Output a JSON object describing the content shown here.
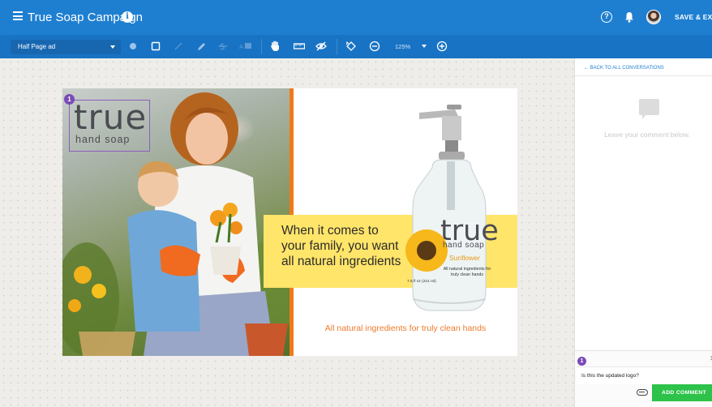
{
  "header": {
    "title": "True Soap Campaign",
    "save_exit": "SAVE & EXIT",
    "icons": [
      "menu-icon",
      "info-icon",
      "help-icon",
      "bell-icon",
      "avatar"
    ]
  },
  "toolbar": {
    "size_select": "Half Page ad",
    "zoom": "125%",
    "tools": [
      "circle-icon",
      "square-icon",
      "arrow-icon",
      "pen-icon",
      "strikethrough-icon",
      "text-replace-icon",
      "hand-icon",
      "ruler-icon",
      "hide-icon",
      "rotate-icon",
      "zoom-out-icon",
      "zoom-in-icon"
    ]
  },
  "ad": {
    "logo_main": "true",
    "logo_sub": "hand soap",
    "tagline": "When it comes to your family, you want all natural ingredients",
    "bottom_tagline": "All natural ingredients for truly clean hands",
    "bottle": {
      "brand": "true",
      "sub": "hand soap",
      "flavor": "Sunflower",
      "desc": "All natural ingredients for truly clean hands",
      "volume": "7.5 fl oz (221 ml)"
    },
    "pin": "1",
    "colors": {
      "accent_orange": "#f07a19",
      "band_yellow": "#ffe56a",
      "annotation_purple": "#7a4bb6"
    }
  },
  "panel": {
    "back_link": "← BACK TO ALL CONVERSATIONS",
    "empty_msg": "Leave your comment below.",
    "pin": "1",
    "close": "✕",
    "comment_value": "Is this the updated logo?",
    "add_button": "ADD COMMENT"
  }
}
